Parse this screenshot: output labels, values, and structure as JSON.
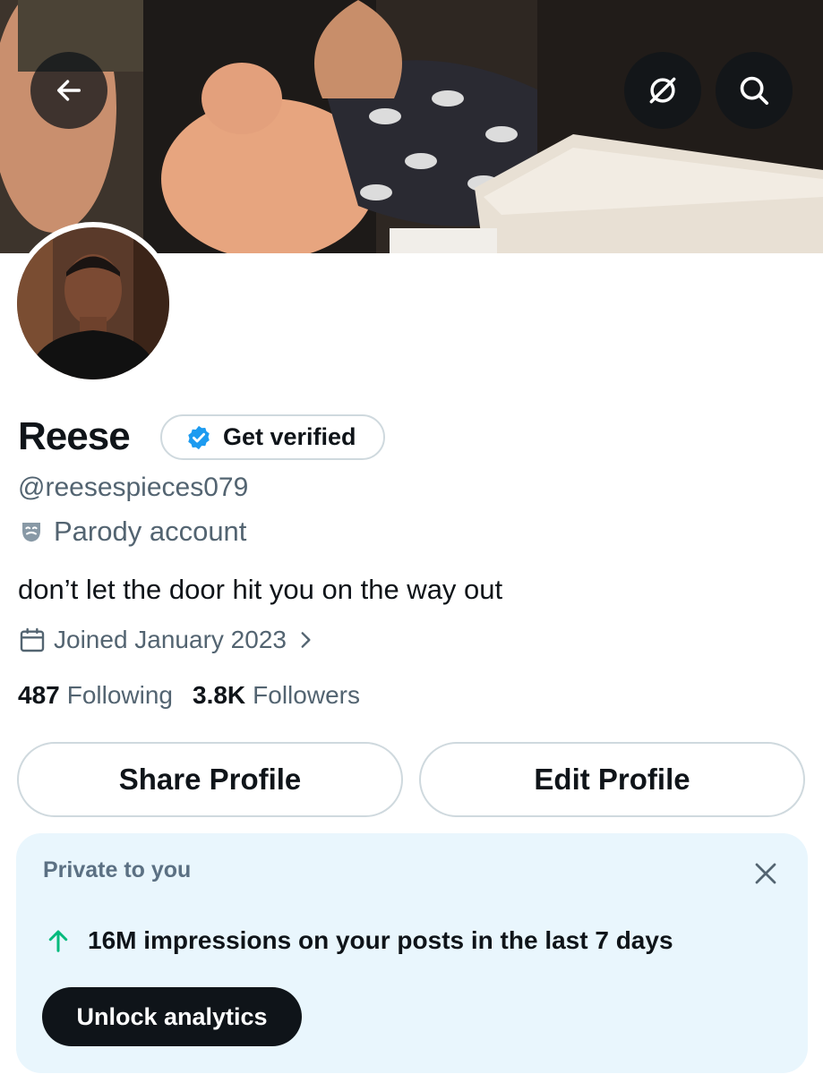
{
  "header": {
    "back_icon": "arrow-left-icon",
    "grok_icon": "grok-icon",
    "search_icon": "search-icon"
  },
  "profile": {
    "name": "Reese",
    "verify_label": "Get verified",
    "handle": "@reesespieces079",
    "parody_label": "Parody account",
    "bio": "don’t let the door hit you on the way out",
    "joined": "Joined January 2023",
    "following_count": "487",
    "following_label": "Following",
    "followers_count": "3.8K",
    "followers_label": "Followers"
  },
  "actions": {
    "share_label": "Share Profile",
    "edit_label": "Edit Profile"
  },
  "private_card": {
    "title": "Private to you",
    "impressions_text": "16M impressions on your posts in the last 7 days",
    "unlock_label": "Unlock analytics"
  },
  "colors": {
    "text_primary": "#0f1419",
    "text_secondary": "#536471",
    "verified_blue": "#1d9bf0",
    "growth_green": "#00ba7c",
    "card_bg": "#e9f6fd"
  }
}
